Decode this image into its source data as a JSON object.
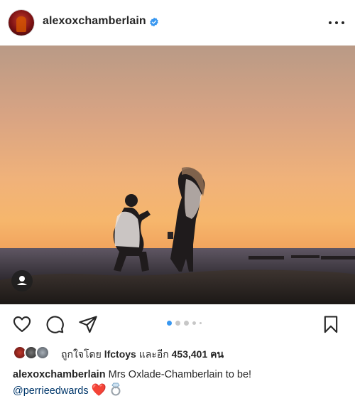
{
  "header": {
    "username": "alexoxchamberlain",
    "verified": true,
    "more_icon": "more-horizontal-icon"
  },
  "post": {
    "photo_description_icon": "proposal-photo",
    "carousel": {
      "current": 1,
      "total": 5
    }
  },
  "actions": {
    "like_icon": "heart-outline-icon",
    "comment_icon": "comment-icon",
    "share_icon": "send-icon",
    "save_icon": "bookmark-icon"
  },
  "likes": {
    "prefix": "ถูกใจโดย",
    "user": "lfctoys",
    "middle": "และอีก",
    "count": "453,401",
    "suffix": "คน"
  },
  "caption": {
    "user": "alexoxchamberlain",
    "text": "Mrs Oxlade-Chamberlain to be!",
    "mention": "@perrieedwards",
    "heart": "❤️"
  },
  "colors": {
    "verified": "#3897f0",
    "active_dot": "#3897f0",
    "inactive_dot": "#c7c7c7",
    "mention": "#00376b"
  }
}
